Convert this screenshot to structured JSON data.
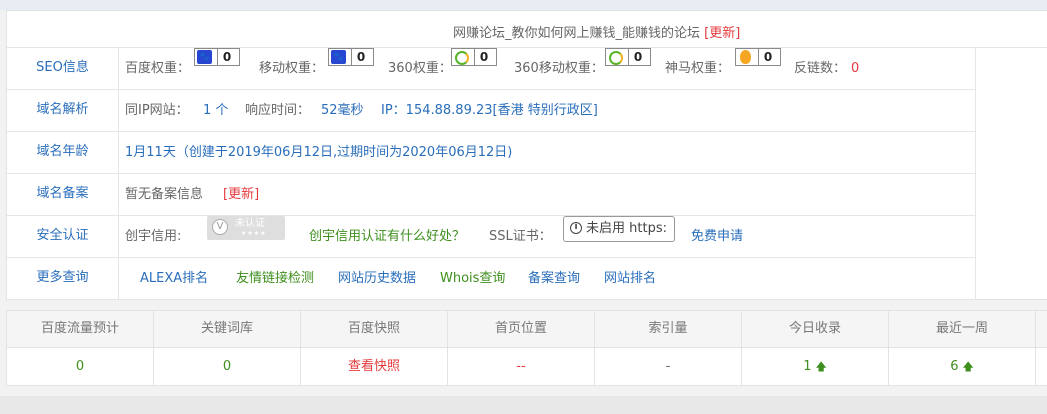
{
  "site_title": "网赚论坛_教你如何网上赚钱_能赚钱的论坛",
  "update_link": "[更新]",
  "rows": {
    "seo": {
      "label": "SEO信息",
      "items": [
        {
          "label": "百度权重：",
          "value": "0",
          "icon": "baidu-paw-icon"
        },
        {
          "label": "移动权重：",
          "value": "0",
          "icon": "baidu-paw-icon"
        },
        {
          "label": "360权重：",
          "value": "0",
          "icon": "360-icon"
        },
        {
          "label": "360移动权重：",
          "value": "0",
          "icon": "360-icon"
        },
        {
          "label": "神马权重：",
          "value": "0",
          "icon": "shenma-icon"
        }
      ],
      "backlinks_label": "反链数：",
      "backlinks_value": "0"
    },
    "dns": {
      "label": "域名解析",
      "same_ip_label": "同IP网站：",
      "same_ip_value": "1 个",
      "response_label": "响应时间：",
      "response_value": "52毫秒",
      "ip_text": "IP：154.88.89.23[香港 特别行政区]"
    },
    "age": {
      "label": "域名年龄",
      "text": "1月11天（创建于2019年06月12日,过期时间为2020年06月12日)"
    },
    "icp": {
      "label": "域名备案",
      "text": "暂无备案信息",
      "update": "[更新]"
    },
    "security": {
      "label": "安全认证",
      "credit_label": "创宇信用:",
      "cert_text": "未认证",
      "cert_stars": "★★★★",
      "credit_link": "创宇信用认证有什么好处？",
      "ssl_label": "SSL证书：",
      "ssl_button": "未启用 https:",
      "free_apply": "免费申请"
    },
    "more": {
      "label": "更多查询",
      "links": [
        "ALEXA排名",
        "友情链接检测",
        "网站历史数据",
        "Whois查询",
        "备案查询",
        "网站排名"
      ]
    }
  },
  "stats": {
    "headers": [
      "百度流量预计",
      "关键词库",
      "百度快照",
      "首页位置",
      "索引量",
      "今日收录",
      "最近一周"
    ],
    "values": [
      "0",
      "0",
      "查看快照",
      "--",
      "-",
      "1",
      "6"
    ]
  },
  "colors": {
    "link_blue": "#2a6ebb",
    "red": "#e4393c",
    "green": "#3f8f1f"
  }
}
